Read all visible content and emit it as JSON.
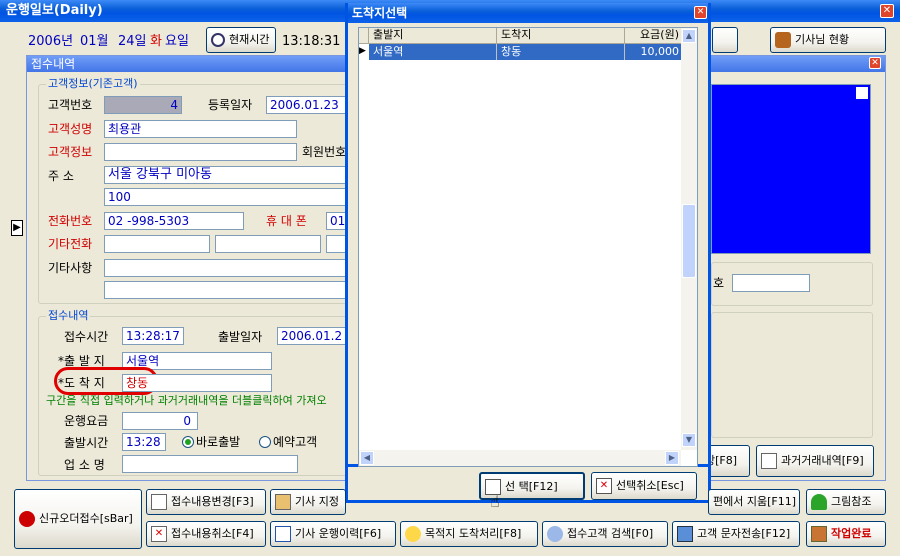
{
  "main_window": {
    "title": "운행일보(Daily)",
    "top_bar": {
      "year": "2006년",
      "month": "01월",
      "day": "24일",
      "weekday": "화",
      "weekday_suffix": "요일",
      "current_time_button": "현재시간",
      "clock": "13:18:31",
      "driver_status_button": "기사님 현황"
    }
  },
  "reception_panel": {
    "title": "접수내역",
    "customer_group": {
      "caption": "고객정보(기존고객)",
      "customer_no_label": "고객번호",
      "customer_no": "4",
      "reg_date_label": "등록일자",
      "reg_date": "2006.01.23",
      "name_label": "고객성명",
      "name": "최용관",
      "info_label": "고객정보",
      "info": "",
      "member_no_label": "회원번호",
      "address_label": "주    소",
      "address1": "서울 강북구 미아동",
      "address2": "100",
      "phone_label": "전화번호",
      "phone": "02  -998-5303",
      "mobile_label": "휴 대 폰",
      "mobile": "01",
      "other_phone_label": "기타전화",
      "other_label": "기타사항",
      "right_partial_label": "호"
    },
    "order_group": {
      "caption": "접수내역",
      "time_label": "접수시간",
      "time": "13:28:17",
      "depart_date_label": "출발일자",
      "depart_date": "2006.01.2",
      "origin_label": "*출 발 지",
      "origin": "서울역",
      "dest_label": "*도 착 지",
      "dest": "창동",
      "hint": "구간을 직접 입력하거나 과거거래내역을 더블클릭하여 가져오",
      "fare_label": "운행요금",
      "fare": "0",
      "depart_time_label": "출발시간",
      "depart_time": "13:28",
      "radio_now": "바로출발",
      "radio_reserve": "예약고객",
      "office_label": "업 소 명"
    }
  },
  "dialog": {
    "title": "도착지선택",
    "columns": [
      "출발지",
      "도착지",
      "요금(원)"
    ],
    "rows": [
      {
        "origin": "서울역",
        "dest": "창동",
        "fare": "10,000"
      }
    ],
    "select_button": "선  택[F12]",
    "cancel_button": "선택취소[Esc]"
  },
  "right_buttons": {
    "f8_partial": "방[F8]",
    "history_button": "과거거래내역[F9]"
  },
  "bottom_buttons": {
    "new_order": "신규오더접수[sBar]",
    "edit": "접수내용변경[F3]",
    "driver_assign": "기사 지정",
    "delete_from": "편에서 지움[F11]",
    "photo_ref": "그림참조",
    "cancel_order": "접수내용취소[F4]",
    "driver_history": "기사 운행이력[F6]",
    "arrival": "목적지 도착처리[F8]",
    "customer_search": "접수고객 검색[F0]",
    "sms": "고객 문자전송[F12]",
    "finish": "작업완료"
  },
  "colors": {
    "title_blue": "#0054e3",
    "field_text": "#0000c0",
    "label_red": "#d00000",
    "selected_row": "#316ac5",
    "right_panel": "#0000ff",
    "finish_text": "#d00000"
  }
}
